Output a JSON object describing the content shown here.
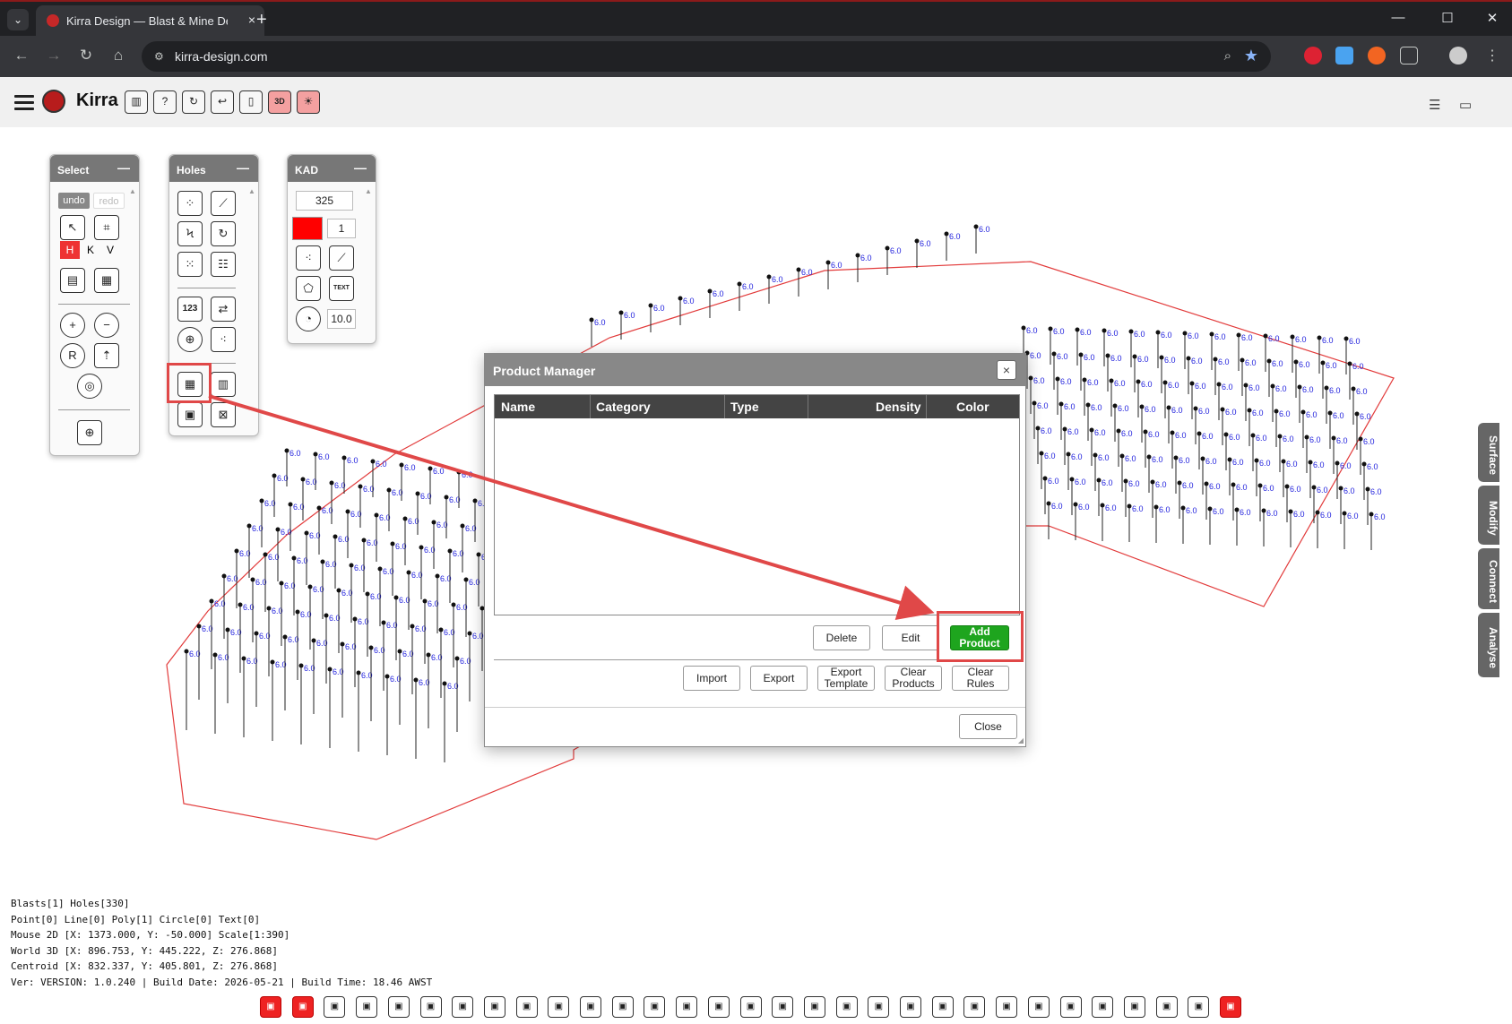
{
  "browser": {
    "tab_title": "Kirra Design — Blast & Mine De...",
    "tab_close": "×",
    "new_tab": "+",
    "url": "kirra-design.com",
    "window_controls": [
      "—",
      "☐",
      "✕"
    ]
  },
  "app": {
    "brand": "Kirra",
    "header_icons": [
      "book-icon",
      "help-icon",
      "reload-icon",
      "undo-arrow-icon",
      "layout-icon",
      "3d-icon",
      "sun-icon"
    ],
    "header_3d_label": "3D"
  },
  "select_panel": {
    "title": "Select",
    "minimize": "—",
    "undo_label": "undo",
    "redo_label": "redo",
    "toggle_h": "H",
    "toggle_k": "K",
    "toggle_v": "V"
  },
  "holes_panel": {
    "title": "Holes",
    "minimize": "—",
    "number_tool": "123"
  },
  "kad_panel": {
    "title": "KAD",
    "minimize": "—",
    "point_value": "325",
    "color_value": "#ff0000",
    "line_width": "1",
    "font_size": "10.0",
    "text_tool_label": "TEXT"
  },
  "product_manager": {
    "title": "Product Manager",
    "close_x": "×",
    "columns": [
      "Name",
      "Category",
      "Type",
      "Density",
      "Color"
    ],
    "rows": [],
    "buttons": {
      "delete": "Delete",
      "edit": "Edit",
      "add_product": "Add Product",
      "import": "Import",
      "export": "Export",
      "export_template": "Export Template",
      "clear_products": "Clear Products",
      "clear_rules": "Clear Rules",
      "close": "Close"
    },
    "accent_color": "#1ea51e"
  },
  "side_tabs": [
    "Surface",
    "Modify",
    "Connect",
    "Analyse"
  ],
  "status": {
    "line1": "Blasts[1] Holes[330]",
    "line2": "Point[0] Line[0] Poly[1] Circle[0] Text[0]",
    "line3": "Mouse 2D [X: 1373.000, Y: -50.000] Scale[1:390]",
    "line4": "World 3D [X: 896.753, Y: 445.222, Z: 276.868]",
    "line5": "Centroid [X: 832.337, Y: 405.801, Z: 276.868]",
    "line6": "Ver: VERSION: 1.0.240 | Build Date: 2026-05-21 | Build Time: 18.46 AWST"
  },
  "bottom_toolbar_count": 31,
  "plot": {
    "hole_label": "6.0",
    "boundary_color": "#e23b3b",
    "label_color": "#2222dd"
  }
}
